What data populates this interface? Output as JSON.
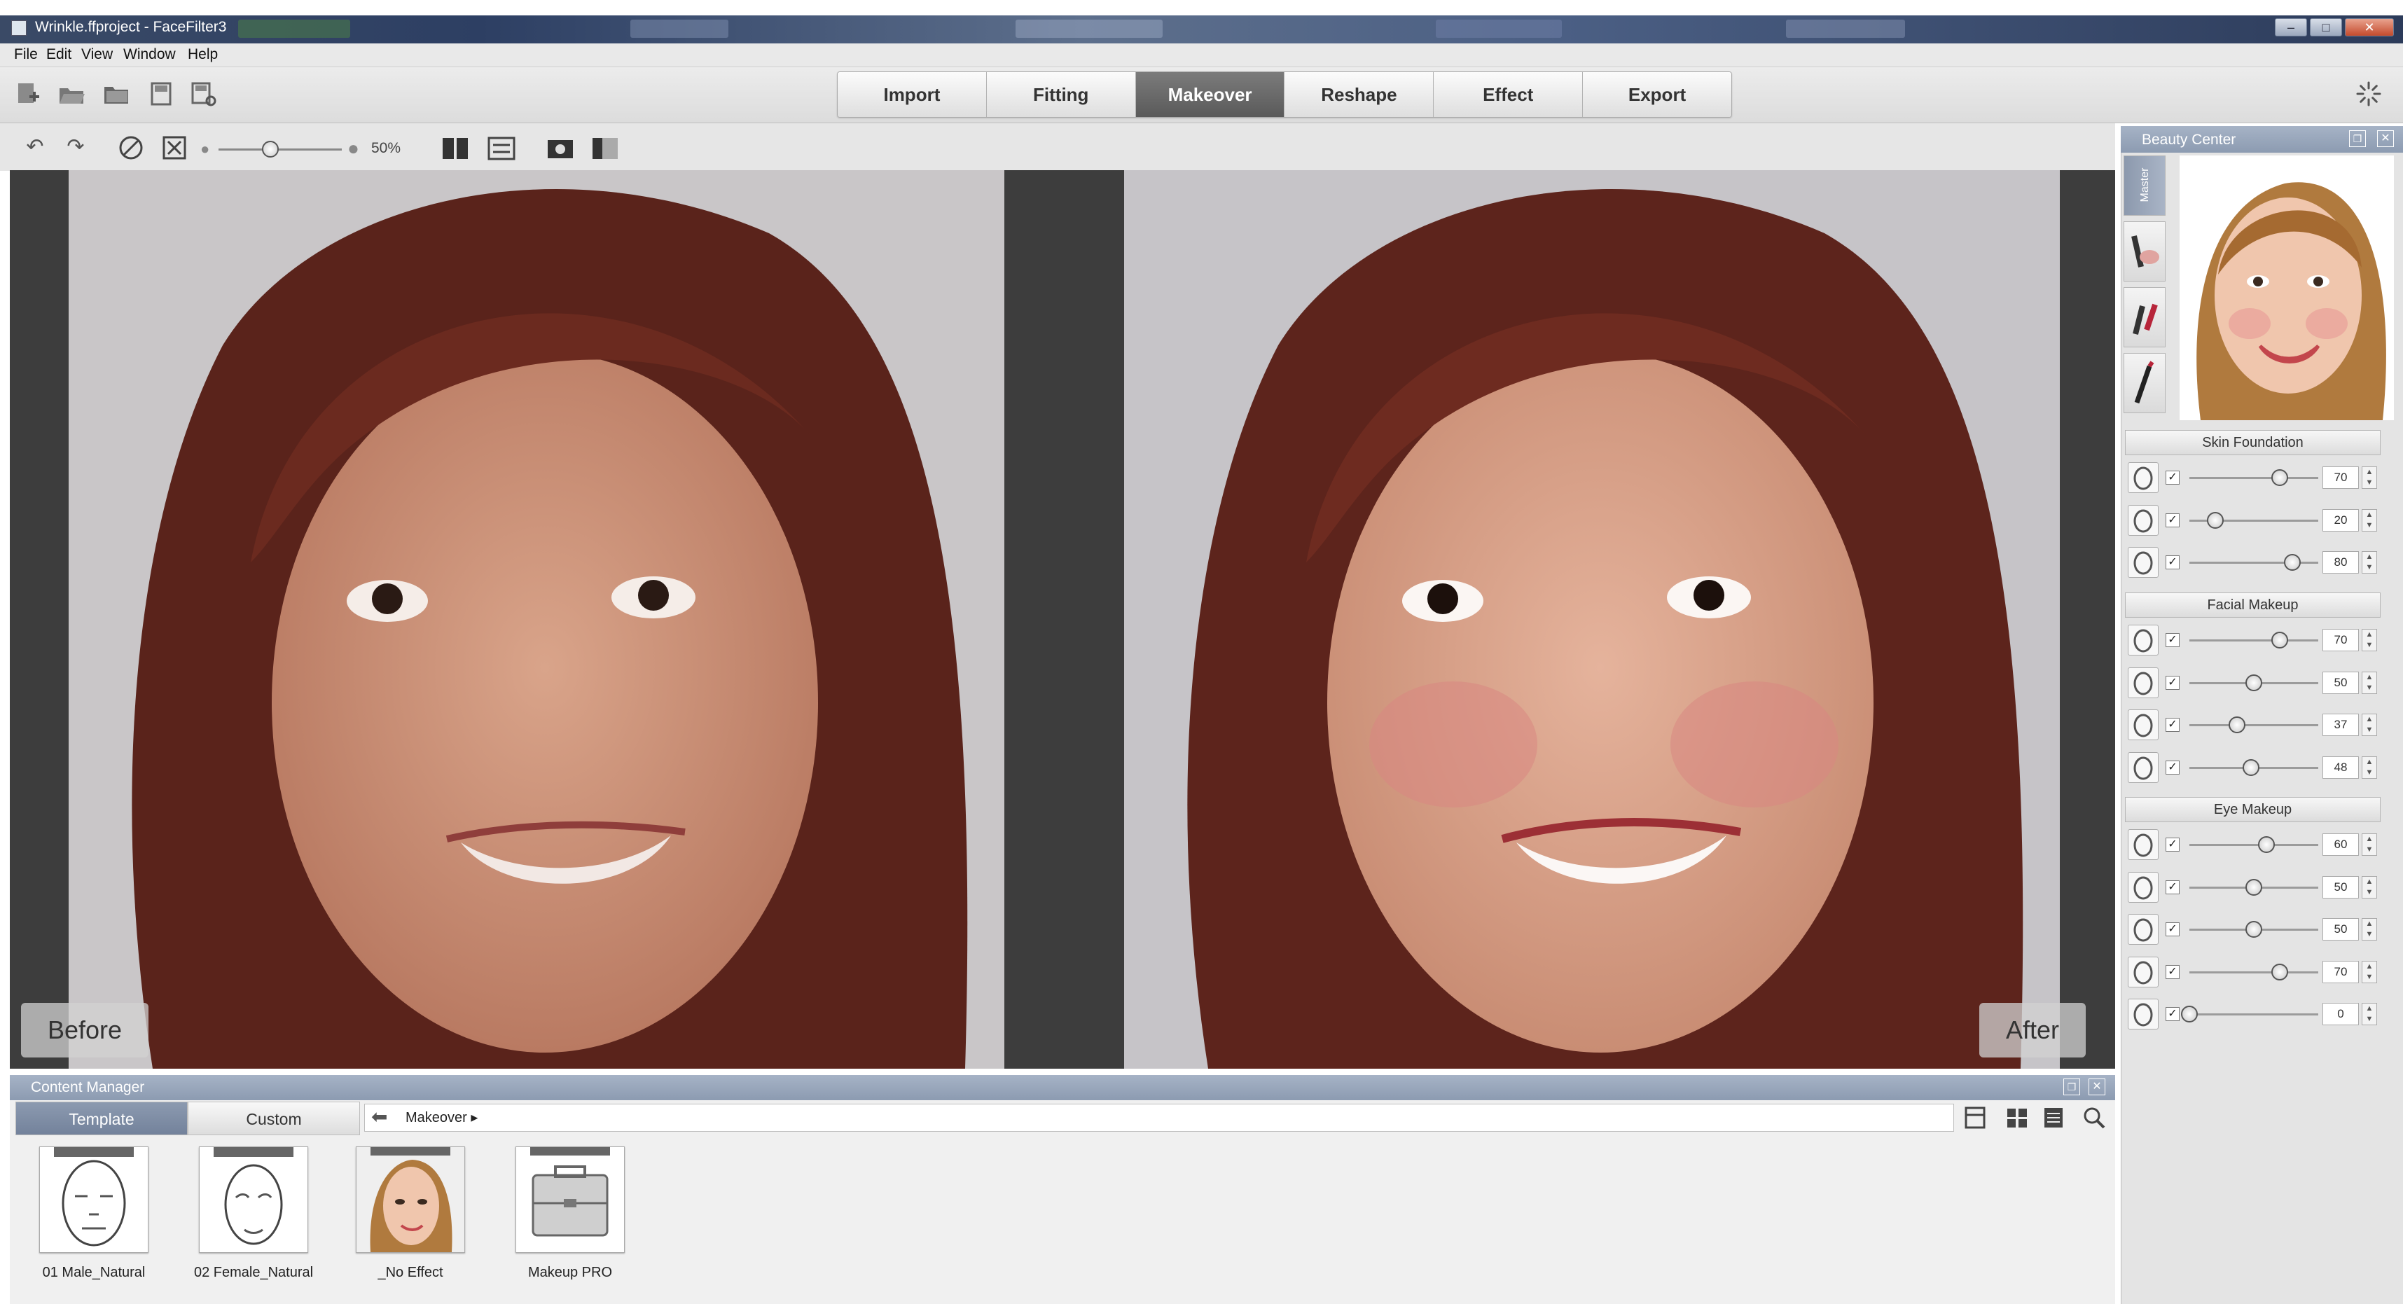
{
  "window": {
    "title": "Wrinkle.ffproject - FaceFilter3",
    "controls": [
      "–",
      "□",
      "✕"
    ]
  },
  "menu": [
    "File",
    "Edit",
    "View",
    "Window",
    "Help"
  ],
  "modes": [
    {
      "label": "Import",
      "active": false
    },
    {
      "label": "Fitting",
      "active": false
    },
    {
      "label": "Makeover",
      "active": true
    },
    {
      "label": "Reshape",
      "active": false
    },
    {
      "label": "Effect",
      "active": false
    },
    {
      "label": "Export",
      "active": false
    }
  ],
  "toolbar": {
    "icons": [
      "new-project-icon",
      "open-icon",
      "open-folder-icon",
      "save-icon",
      "save-as-icon"
    ],
    "secondary_icons": [
      "undo-icon",
      "redo-icon",
      "reset-icon",
      "fit-icon"
    ],
    "zoom_value": "50%",
    "zoom_fraction": 0.42
  },
  "viewer": {
    "before_label": "Before",
    "after_label": "After"
  },
  "beauty_center": {
    "title": "Beauty Center",
    "master_tab": "Master",
    "sections": [
      {
        "name": "Skin Foundation",
        "sliders": [
          {
            "icon": "face-shield-icon",
            "value": 70
          },
          {
            "icon": "face-smooth-icon",
            "value": 20
          },
          {
            "icon": "face-outline-icon",
            "value": 80
          }
        ]
      },
      {
        "name": "Facial Makeup",
        "sliders": [
          {
            "icon": "face-contour-icon",
            "value": 70
          },
          {
            "icon": "cheek-icon",
            "value": 50
          },
          {
            "icon": "lips-color-icon",
            "value": 37
          },
          {
            "icon": "lips-icon",
            "value": 48
          }
        ]
      },
      {
        "name": "Eye Makeup",
        "sliders": [
          {
            "icon": "eyebrow-icon",
            "value": 60
          },
          {
            "icon": "eyeliner-icon",
            "value": 50
          },
          {
            "icon": "eye-outline-icon",
            "value": 50
          },
          {
            "icon": "eyeshadow-icon",
            "value": 70
          },
          {
            "icon": "iris-icon",
            "value": 0
          }
        ]
      }
    ]
  },
  "content_manager": {
    "title": "Content Manager",
    "tabs": [
      {
        "label": "Template",
        "active": true
      },
      {
        "label": "Custom",
        "active": false
      }
    ],
    "path": "Makeover ▸",
    "items": [
      {
        "label": "01 Male_Natural"
      },
      {
        "label": "02 Female_Natural"
      },
      {
        "label": "_No Effect"
      },
      {
        "label": "Makeup PRO"
      }
    ]
  }
}
